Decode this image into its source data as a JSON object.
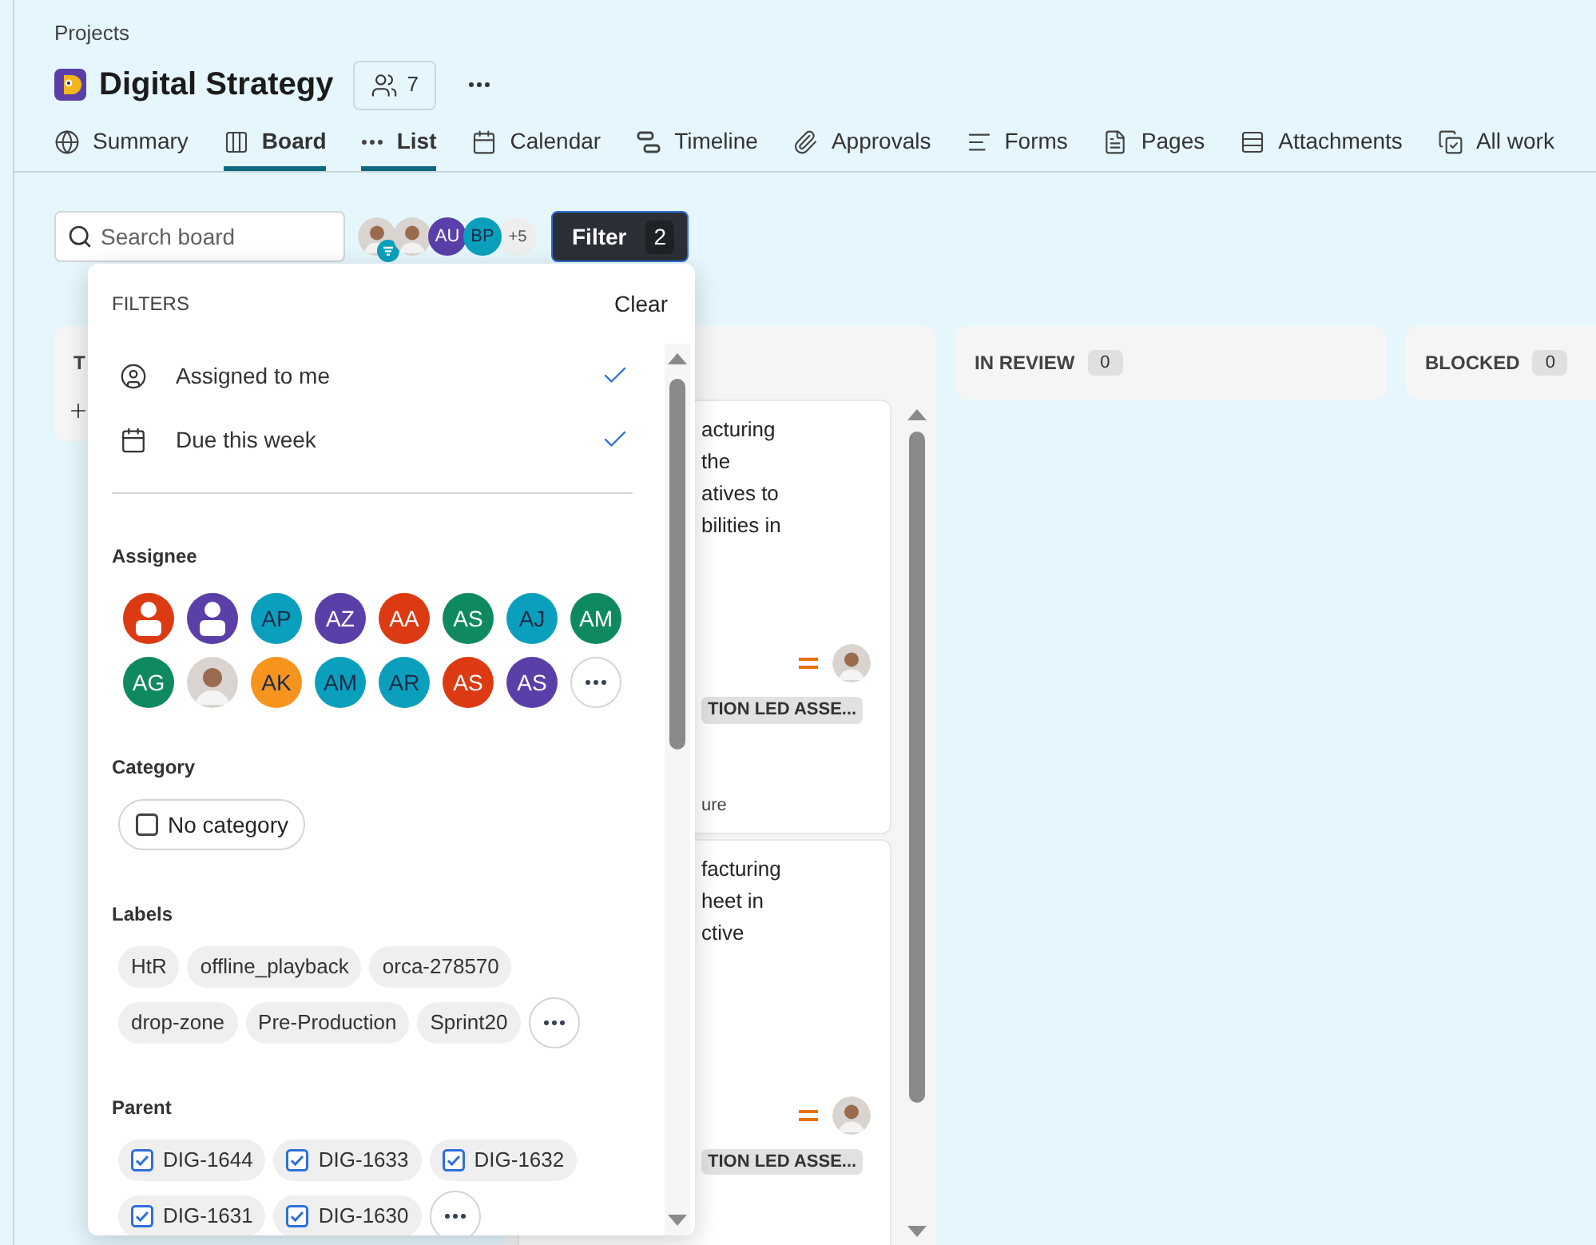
{
  "breadcrumb": "Projects",
  "project": {
    "title": "Digital Strategy",
    "members_count": "7"
  },
  "tabs": [
    {
      "label": "Summary",
      "selected": false
    },
    {
      "label": "Board",
      "selected": true
    },
    {
      "label": "List",
      "selected": true
    },
    {
      "label": "Calendar",
      "selected": false
    },
    {
      "label": "Timeline",
      "selected": false
    },
    {
      "label": "Approvals",
      "selected": false
    },
    {
      "label": "Forms",
      "selected": false
    },
    {
      "label": "Pages",
      "selected": false
    },
    {
      "label": "Attachments",
      "selected": false
    },
    {
      "label": "All work",
      "selected": false
    }
  ],
  "toolbar": {
    "search": {
      "placeholder": "Search board"
    },
    "avatars": [
      {
        "kind": "photo",
        "filtered": true
      },
      {
        "kind": "photo",
        "filtered": false
      },
      {
        "kind": "initials",
        "initials": "AU",
        "color": "#5b3fa8",
        "filtered": false
      },
      {
        "kind": "initials",
        "initials": "BP",
        "color": "#0aa0bd",
        "filtered": false
      }
    ],
    "more_count": "+5",
    "filter": {
      "label": "Filter",
      "count": "2"
    }
  },
  "board": {
    "columns": [
      {
        "title": "T",
        "add": true
      },
      {
        "add": false,
        "cards": [
          {
            "lines": [
              "acturing",
              "the",
              "atives to",
              "bilities in"
            ],
            "priority": {
              "kind": "medium"
            },
            "tag": "TION LED ASSE...",
            "footer": "ure"
          },
          {
            "lines": [
              "facturing",
              "heet in",
              "ctive"
            ],
            "priority": {
              "kind": "medium"
            },
            "tag": "TION LED ASSE..."
          }
        ]
      },
      {
        "title": "IN REVIEW",
        "count": "0",
        "add": false
      },
      {
        "title": "BLOCKED",
        "count": "0",
        "add": false
      }
    ]
  },
  "filters_panel": {
    "title": "FILTERS",
    "clear": "Clear",
    "quick": [
      {
        "label": "Assigned to me",
        "checked": true
      },
      {
        "label": "Due this week",
        "checked": true
      }
    ],
    "assignee": {
      "label": "Assignee",
      "people": [
        {
          "kind": "placeholder",
          "color": "#dc3a12"
        },
        {
          "kind": "placeholder",
          "color": "#5b3fa8"
        },
        {
          "kind": "initials",
          "initials": "AP",
          "color": "#0aa0bd"
        },
        {
          "kind": "initials",
          "initials": "AZ",
          "color": "#5b3fa8"
        },
        {
          "kind": "initials",
          "initials": "AA",
          "color": "#dc3a12"
        },
        {
          "kind": "initials",
          "initials": "AS",
          "color": "#0f8a5f"
        },
        {
          "kind": "initials",
          "initials": "AJ",
          "color": "#0aa0bd"
        },
        {
          "kind": "initials",
          "initials": "AM",
          "color": "#0f8a5f"
        },
        {
          "kind": "initials",
          "initials": "AG",
          "color": "#0f8a5f"
        },
        {
          "kind": "photo"
        },
        {
          "kind": "initials",
          "initials": "AK",
          "color": "#f7941d"
        },
        {
          "kind": "initials",
          "initials": "AM",
          "color": "#0aa0bd"
        },
        {
          "kind": "initials",
          "initials": "AR",
          "color": "#0aa0bd"
        },
        {
          "kind": "initials",
          "initials": "AS",
          "color": "#dc3a12"
        },
        {
          "kind": "initials",
          "initials": "AS",
          "color": "#5b3fa8"
        }
      ]
    },
    "category": {
      "label": "Category",
      "options": [
        {
          "label": "No category",
          "checked": false
        }
      ]
    },
    "labels": {
      "label": "Labels",
      "items": [
        "HtR",
        "offline_playback",
        "orca-278570",
        "drop-zone",
        "Pre-Production",
        "Sprint20"
      ]
    },
    "parent": {
      "label": "Parent",
      "items": [
        {
          "label": "DIG-1644",
          "checked": true
        },
        {
          "label": "DIG-1633",
          "checked": true
        },
        {
          "label": "DIG-1632",
          "checked": true
        },
        {
          "label": "DIG-1631",
          "checked": true
        },
        {
          "label": "DIG-1630",
          "checked": true
        }
      ]
    }
  }
}
